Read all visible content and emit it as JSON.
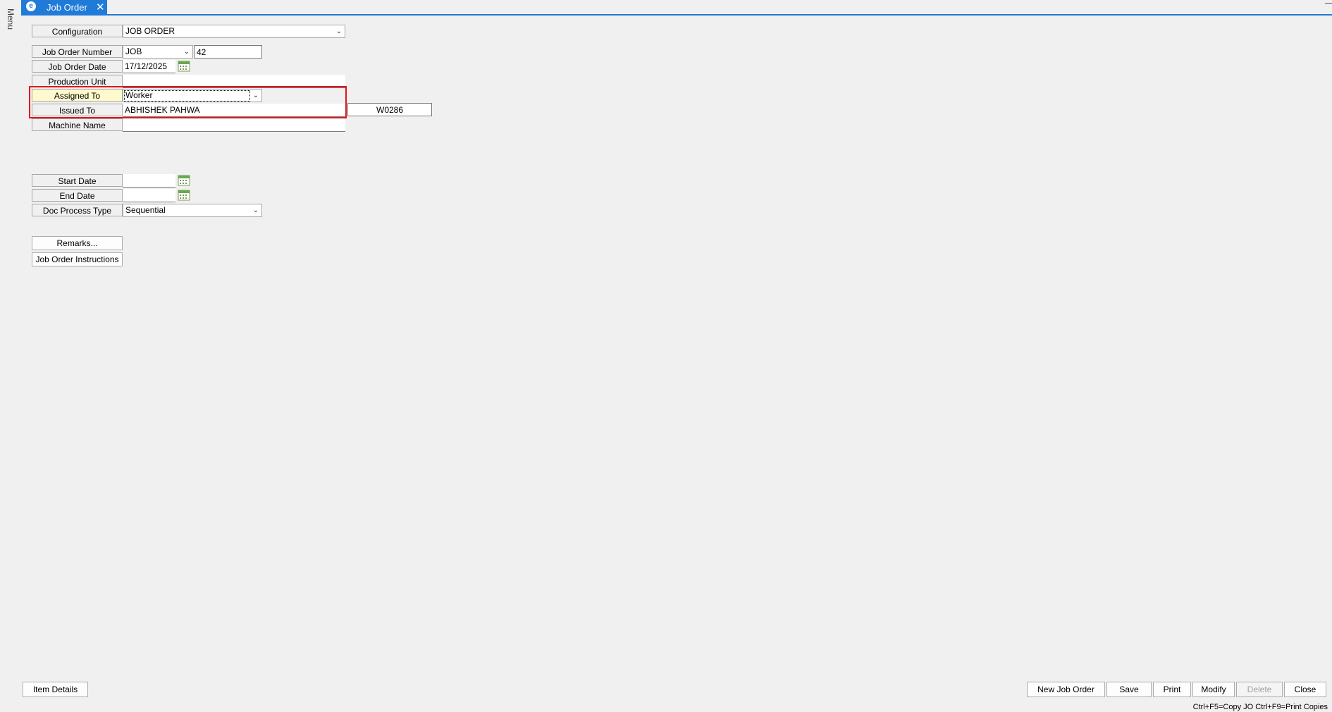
{
  "sidebar": {
    "menu_label": "Menu"
  },
  "tab": {
    "title": "Job Order",
    "close_glyph": "✕"
  },
  "form": {
    "configuration": {
      "label": "Configuration",
      "value": "JOB ORDER"
    },
    "job_order_number": {
      "label": "Job Order Number",
      "prefix": "JOB",
      "number": "42"
    },
    "job_order_date": {
      "label": "Job Order Date",
      "value": "17/12/2025"
    },
    "production_unit": {
      "label": "Production Unit",
      "value": ""
    },
    "assigned_to": {
      "label": "Assigned To",
      "value": "Worker"
    },
    "issued_to": {
      "label": "Issued To",
      "value": "ABHISHEK PAHWA",
      "code": "W0286"
    },
    "machine_name": {
      "label": "Machine Name",
      "value": ""
    },
    "start_date": {
      "label": "Start Date",
      "value": ""
    },
    "end_date": {
      "label": "End Date",
      "value": ""
    },
    "doc_process_type": {
      "label": "Doc Process Type",
      "value": "Sequential"
    }
  },
  "buttons": {
    "remarks": "Remarks...",
    "instructions": "Job Order Instructions",
    "item_details": "Item Details",
    "new_job_order": "New Job Order",
    "save": "Save",
    "print": "Print",
    "modify": "Modify",
    "delete": "Delete",
    "close": "Close"
  },
  "status_bar": {
    "shortcuts": "Ctrl+F5=Copy JO  Ctrl+F9=Print Copies"
  },
  "colors": {
    "accent": "#1f7ad8",
    "highlight_border": "#e4141b",
    "focus_label": "#fffacd"
  }
}
